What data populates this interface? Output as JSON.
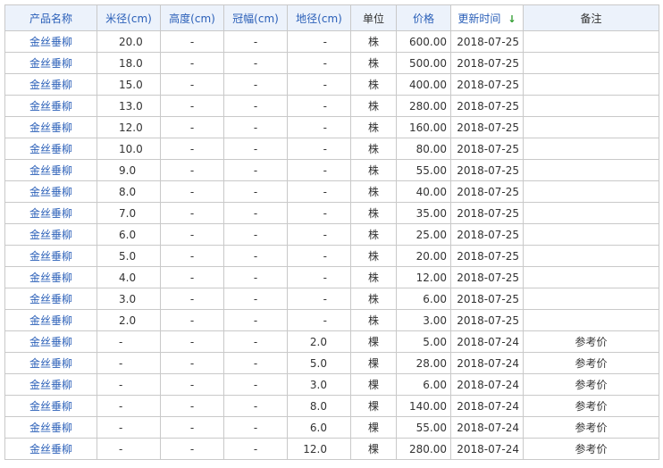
{
  "table": {
    "headers": {
      "name": "产品名称",
      "mi": "米径(cm)",
      "height": "高度(cm)",
      "crown": "冠幅(cm)",
      "ground": "地径(cm)",
      "unit": "单位",
      "price": "价格",
      "updated": "更新时间",
      "sort_icon": "↓",
      "note": "备注"
    },
    "rows": [
      {
        "name": "金丝垂柳",
        "mi": "20.0",
        "height": "-",
        "crown": "-",
        "ground": "-",
        "unit": "株",
        "price": "600.00",
        "updated": "2018-07-25",
        "note": ""
      },
      {
        "name": "金丝垂柳",
        "mi": "18.0",
        "height": "-",
        "crown": "-",
        "ground": "-",
        "unit": "株",
        "price": "500.00",
        "updated": "2018-07-25",
        "note": ""
      },
      {
        "name": "金丝垂柳",
        "mi": "15.0",
        "height": "-",
        "crown": "-",
        "ground": "-",
        "unit": "株",
        "price": "400.00",
        "updated": "2018-07-25",
        "note": ""
      },
      {
        "name": "金丝垂柳",
        "mi": "13.0",
        "height": "-",
        "crown": "-",
        "ground": "-",
        "unit": "株",
        "price": "280.00",
        "updated": "2018-07-25",
        "note": ""
      },
      {
        "name": "金丝垂柳",
        "mi": "12.0",
        "height": "-",
        "crown": "-",
        "ground": "-",
        "unit": "株",
        "price": "160.00",
        "updated": "2018-07-25",
        "note": ""
      },
      {
        "name": "金丝垂柳",
        "mi": "10.0",
        "height": "-",
        "crown": "-",
        "ground": "-",
        "unit": "株",
        "price": "80.00",
        "updated": "2018-07-25",
        "note": ""
      },
      {
        "name": "金丝垂柳",
        "mi": "9.0",
        "height": "-",
        "crown": "-",
        "ground": "-",
        "unit": "株",
        "price": "55.00",
        "updated": "2018-07-25",
        "note": ""
      },
      {
        "name": "金丝垂柳",
        "mi": "8.0",
        "height": "-",
        "crown": "-",
        "ground": "-",
        "unit": "株",
        "price": "40.00",
        "updated": "2018-07-25",
        "note": ""
      },
      {
        "name": "金丝垂柳",
        "mi": "7.0",
        "height": "-",
        "crown": "-",
        "ground": "-",
        "unit": "株",
        "price": "35.00",
        "updated": "2018-07-25",
        "note": ""
      },
      {
        "name": "金丝垂柳",
        "mi": "6.0",
        "height": "-",
        "crown": "-",
        "ground": "-",
        "unit": "株",
        "price": "25.00",
        "updated": "2018-07-25",
        "note": ""
      },
      {
        "name": "金丝垂柳",
        "mi": "5.0",
        "height": "-",
        "crown": "-",
        "ground": "-",
        "unit": "株",
        "price": "20.00",
        "updated": "2018-07-25",
        "note": ""
      },
      {
        "name": "金丝垂柳",
        "mi": "4.0",
        "height": "-",
        "crown": "-",
        "ground": "-",
        "unit": "株",
        "price": "12.00",
        "updated": "2018-07-25",
        "note": ""
      },
      {
        "name": "金丝垂柳",
        "mi": "3.0",
        "height": "-",
        "crown": "-",
        "ground": "-",
        "unit": "株",
        "price": "6.00",
        "updated": "2018-07-25",
        "note": ""
      },
      {
        "name": "金丝垂柳",
        "mi": "2.0",
        "height": "-",
        "crown": "-",
        "ground": "-",
        "unit": "株",
        "price": "3.00",
        "updated": "2018-07-25",
        "note": ""
      },
      {
        "name": "金丝垂柳",
        "mi": "-",
        "height": "-",
        "crown": "-",
        "ground": "2.0",
        "unit": "棵",
        "price": "5.00",
        "updated": "2018-07-24",
        "note": "参考价"
      },
      {
        "name": "金丝垂柳",
        "mi": "-",
        "height": "-",
        "crown": "-",
        "ground": "5.0",
        "unit": "棵",
        "price": "28.00",
        "updated": "2018-07-24",
        "note": "参考价"
      },
      {
        "name": "金丝垂柳",
        "mi": "-",
        "height": "-",
        "crown": "-",
        "ground": "3.0",
        "unit": "棵",
        "price": "6.00",
        "updated": "2018-07-24",
        "note": "参考价"
      },
      {
        "name": "金丝垂柳",
        "mi": "-",
        "height": "-",
        "crown": "-",
        "ground": "8.0",
        "unit": "棵",
        "price": "140.00",
        "updated": "2018-07-24",
        "note": "参考价"
      },
      {
        "name": "金丝垂柳",
        "mi": "-",
        "height": "-",
        "crown": "-",
        "ground": "6.0",
        "unit": "棵",
        "price": "55.00",
        "updated": "2018-07-24",
        "note": "参考价"
      },
      {
        "name": "金丝垂柳",
        "mi": "-",
        "height": "-",
        "crown": "-",
        "ground": "12.0",
        "unit": "棵",
        "price": "280.00",
        "updated": "2018-07-24",
        "note": "参考价"
      }
    ]
  },
  "colors": {
    "header_bg": "#ecf2fb",
    "link_blue": "#2a5fb8",
    "sort_arrow_green": "#2b9b2b",
    "border": "#c9c9c9"
  }
}
